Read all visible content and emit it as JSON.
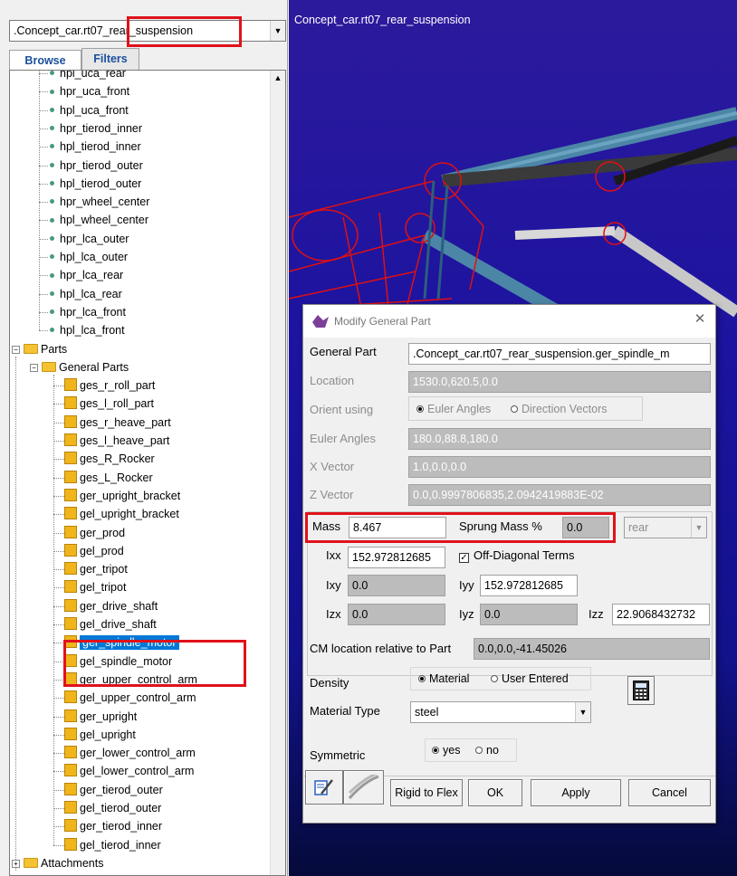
{
  "model_selector": {
    "value": ".Concept_car.rt07_rear_suspension"
  },
  "tabs": {
    "browse": "Browse",
    "filters": "Filters"
  },
  "tree": {
    "points": [
      "hpl_uca_rear",
      "hpr_uca_front",
      "hpl_uca_front",
      "hpr_tierod_inner",
      "hpl_tierod_inner",
      "hpr_tierod_outer",
      "hpl_tierod_outer",
      "hpr_wheel_center",
      "hpl_wheel_center",
      "hpr_lca_outer",
      "hpl_lca_outer",
      "hpr_lca_rear",
      "hpl_lca_rear",
      "hpr_lca_front",
      "hpl_lca_front"
    ],
    "parts_label": "Parts",
    "general_parts_label": "General Parts",
    "parts": [
      "ges_r_roll_part",
      "ges_l_roll_part",
      "ges_r_heave_part",
      "ges_l_heave_part",
      "ges_R_Rocker",
      "ges_L_Rocker",
      "ger_upright_bracket",
      "gel_upright_bracket",
      "ger_prod",
      "gel_prod",
      "ger_tripot",
      "gel_tripot",
      "ger_drive_shaft",
      "gel_drive_shaft",
      "ger_spindle_motor",
      "gel_spindle_motor",
      "ger_upper_control_arm",
      "gel_upper_control_arm",
      "ger_upright",
      "gel_upright",
      "ger_lower_control_arm",
      "gel_lower_control_arm",
      "ger_tierod_outer",
      "gel_tierod_outer",
      "ger_tierod_inner",
      "gel_tierod_inner"
    ],
    "selected_part": "ger_spindle_motor",
    "attachments_label": "Attachments"
  },
  "viewport": {
    "title": "Concept_car.rt07_rear_suspension"
  },
  "dialog": {
    "title": "Modify General Part",
    "general_part_label": "General Part",
    "general_part_value": ".Concept_car.rt07_rear_suspension.ger_spindle_m",
    "location_label": "Location",
    "location_value": "1530.0,620.5,0.0",
    "orient_label": "Orient using",
    "orient_opt_euler": "Euler Angles",
    "orient_opt_dir": "Direction Vectors",
    "euler_label": "Euler Angles",
    "euler_value": "180.0,88.8,180.0",
    "xvec_label": "X Vector",
    "xvec_value": "1.0,0.0,0.0",
    "zvec_label": "Z Vector",
    "zvec_value": "0.0,0.9997806835,2.0942419883E-02",
    "mass_label": "Mass",
    "mass_value": "8.467",
    "sprung_label": "Sprung Mass %",
    "sprung_value": "0.0",
    "sprung_side": "rear",
    "ixx_label": "Ixx",
    "ixx_value": "152.972812685",
    "offdiag_label": "Off-Diagonal Terms",
    "ixy_label": "Ixy",
    "ixy_value": "0.0",
    "iyy_label": "Iyy",
    "iyy_value": "152.972812685",
    "izx_label": "Izx",
    "izx_value": "0.0",
    "iyz_label": "Iyz",
    "iyz_value": "0.0",
    "izz_label": "Izz",
    "izz_value": "22.9068432732",
    "cm_label": "CM location relative to Part",
    "cm_value": "0.0,0.0,-41.45026",
    "density_label": "Density",
    "density_opt_material": "Material",
    "density_opt_user": "User Entered",
    "material_label": "Material Type",
    "material_value": "steel",
    "symmetric_label": "Symmetric",
    "sym_yes": "yes",
    "sym_no": "no",
    "btn_rigid_to_flex": "Rigid to Flex",
    "btn_ok": "OK",
    "btn_apply": "Apply",
    "btn_cancel": "Cancel"
  }
}
